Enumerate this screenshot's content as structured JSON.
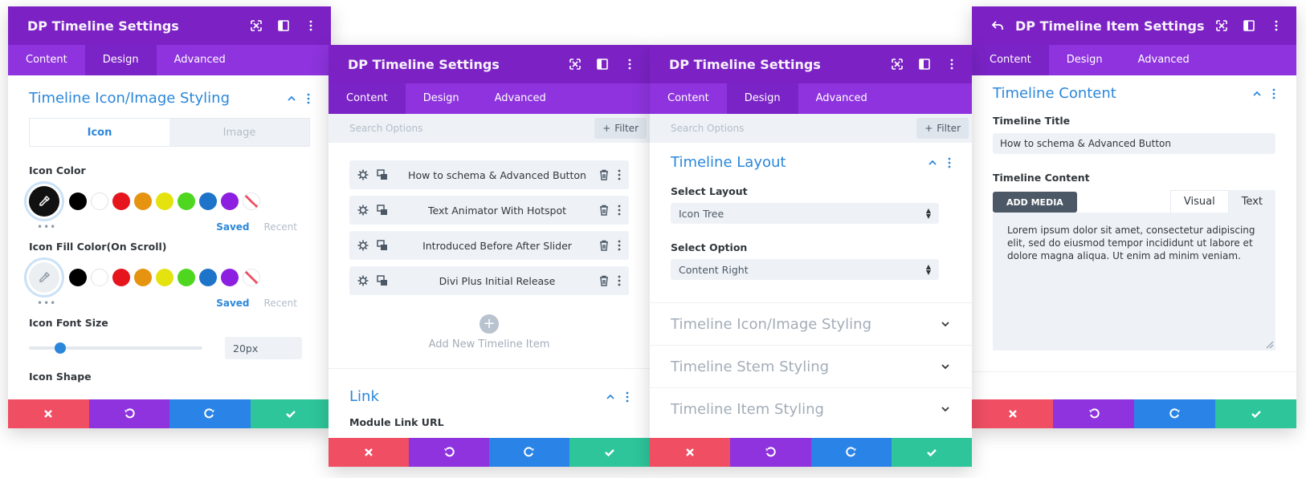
{
  "colors": {
    "header": "#7c22c5",
    "tabbar": "#8e33de",
    "accent": "#2b87da",
    "close": "#ef4e63",
    "undo": "#8e33de",
    "redo": "#2a83e6",
    "save": "#2ec59a"
  },
  "icons": [
    "expand-icon",
    "sidebar-icon",
    "kebab-icon",
    "back-icon",
    "gear-icon",
    "duplicate-icon",
    "trash-icon",
    "chevron-up-icon",
    "chevron-down-icon",
    "close-icon",
    "undo-icon",
    "redo-icon",
    "check-icon",
    "plus-icon",
    "eyedropper-icon"
  ],
  "panel1": {
    "title": "DP Timeline Settings",
    "tabs": [
      "Content",
      "Design",
      "Advanced"
    ],
    "active_tab": "Design",
    "section_title": "Timeline Icon/Image Styling",
    "segment": [
      "Icon",
      "Image"
    ],
    "icon_color_label": "Icon Color",
    "icon_fill_label": "Icon Fill Color(On Scroll)",
    "swatches": [
      "#000000",
      "#ffffff",
      "#e6141d",
      "#e6930f",
      "#e4e30f",
      "#4fd61e",
      "#1d74c9",
      "#8c1fe0"
    ],
    "saved": "Saved",
    "recent": "Recent",
    "more": "•••",
    "font_size_label": "Icon Font Size",
    "font_size_value": "20px",
    "font_size_fraction": 0.18,
    "cut_label": "Icon Shape"
  },
  "panel2": {
    "title": "DP Timeline Settings",
    "tabs": [
      "Content",
      "Design",
      "Advanced"
    ],
    "active_tab": "Content",
    "search_placeholder": "Search Options",
    "filter_label": "Filter",
    "items": [
      "How to schema & Advanced Button",
      "Text Animator With Hotspot",
      "Introduced Before After Slider",
      "Divi Plus Initial Release"
    ],
    "add_plus": "+",
    "add_label": "Add New Timeline Item",
    "link_title": "Link",
    "link_url_label": "Module Link URL"
  },
  "panel3": {
    "title": "DP Timeline Settings",
    "tabs": [
      "Content",
      "Design",
      "Advanced"
    ],
    "active_tab": "Design",
    "search_placeholder": "Search Options",
    "filter_label": "Filter",
    "layout_title": "Timeline Layout",
    "select_layout_label": "Select Layout",
    "select_layout_value": "Icon Tree",
    "select_option_label": "Select Option",
    "select_option_value": "Content Right",
    "collapsed": [
      "Timeline Icon/Image Styling",
      "Timeline Stem Styling",
      "Timeline Item Styling"
    ]
  },
  "panel4": {
    "title": "DP Timeline Item Settings",
    "tabs": [
      "Content",
      "Design",
      "Advanced"
    ],
    "active_tab": "Content",
    "section_title": "Timeline Content",
    "title_label": "Timeline Title",
    "title_value": "How to schema & Advanced Button",
    "content_label": "Timeline Content",
    "add_media": "ADD MEDIA",
    "editor_tabs": [
      "Visual",
      "Text"
    ],
    "content_text": "Lorem ipsum dolor sit amet, consectetur adipiscing elit, sed do eiusmod tempor incididunt ut labore et dolore magna aliqua. Ut enim ad minim veniam."
  }
}
